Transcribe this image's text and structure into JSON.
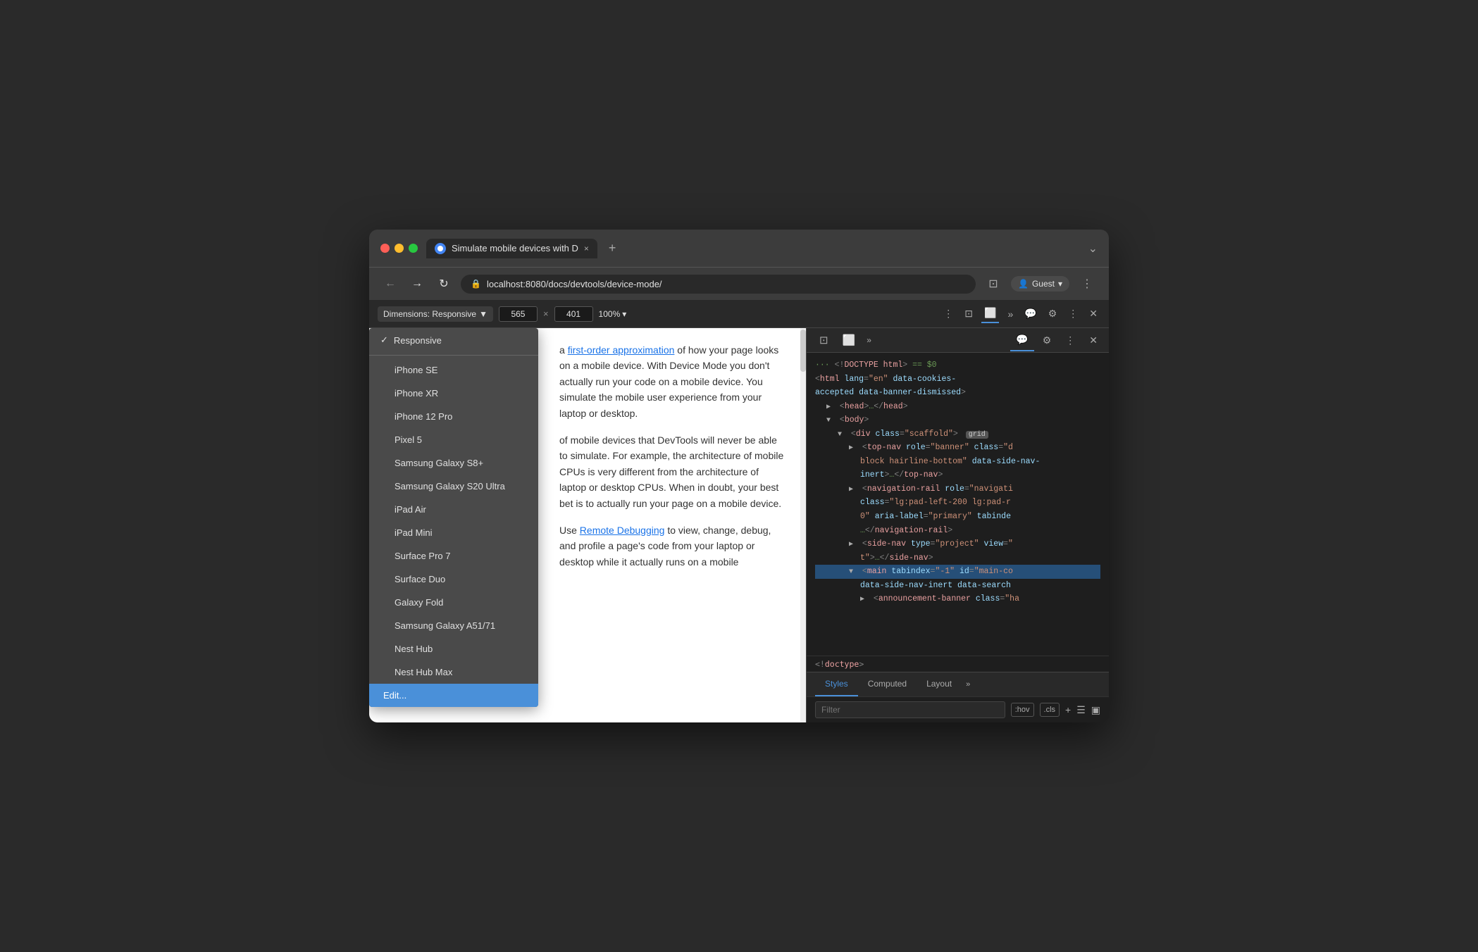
{
  "browser": {
    "tab_title": "Simulate mobile devices with D",
    "tab_close": "×",
    "new_tab": "+",
    "tab_menu": "⌄",
    "address": "localhost:8080/docs/devtools/device-mode/",
    "back_btn": "←",
    "forward_btn": "→",
    "refresh_btn": "↻",
    "profile_icon": "👤",
    "profile_label": "Guest",
    "profile_chevron": "▾",
    "browser_menu": "⋮"
  },
  "devtools_toolbar": {
    "dimensions_label": "Dimensions: Responsive",
    "dimensions_arrow": "▼",
    "width_value": "565",
    "height_value": "401",
    "zoom_label": "100%",
    "zoom_arrow": "▾",
    "more_icon": "⋮"
  },
  "device_dropdown": {
    "items": [
      {
        "id": "responsive",
        "label": "Responsive",
        "checked": true
      },
      {
        "id": "iphone-se",
        "label": "iPhone SE",
        "checked": false
      },
      {
        "id": "iphone-xr",
        "label": "iPhone XR",
        "checked": false
      },
      {
        "id": "iphone-12-pro",
        "label": "iPhone 12 Pro",
        "checked": false
      },
      {
        "id": "pixel-5",
        "label": "Pixel 5",
        "checked": false
      },
      {
        "id": "samsung-s8",
        "label": "Samsung Galaxy S8+",
        "checked": false
      },
      {
        "id": "samsung-s20",
        "label": "Samsung Galaxy S20 Ultra",
        "checked": false
      },
      {
        "id": "ipad-air",
        "label": "iPad Air",
        "checked": false
      },
      {
        "id": "ipad-mini",
        "label": "iPad Mini",
        "checked": false
      },
      {
        "id": "surface-pro",
        "label": "Surface Pro 7",
        "checked": false
      },
      {
        "id": "surface-duo",
        "label": "Surface Duo",
        "checked": false
      },
      {
        "id": "galaxy-fold",
        "label": "Galaxy Fold",
        "checked": false
      },
      {
        "id": "samsung-a51",
        "label": "Samsung Galaxy A51/71",
        "checked": false
      },
      {
        "id": "nest-hub",
        "label": "Nest Hub",
        "checked": false
      },
      {
        "id": "nest-hub-max",
        "label": "Nest Hub Max",
        "checked": false
      },
      {
        "id": "edit",
        "label": "Edit...",
        "checked": false,
        "special": "edit"
      }
    ]
  },
  "page_content": {
    "paragraph1": "a first-order approximation of how your page looks on a mobile device. With Device Mode you don't actually run your code on a mobile device. You simulate the mobile user experience from your laptop or desktop.",
    "link1": "first-order approximation",
    "paragraph2": "of mobile devices that DevTools will never be able to simulate. For example, the architecture of mobile CPUs is very different from the architecture of laptop or desktop CPUs. When in doubt, your best bet is to actually run your page on a mobile device.",
    "paragraph3_start": "Use ",
    "link2": "Remote Debugging",
    "paragraph3_end": " to view, change, debug, and profile a page's code from your laptop or desktop while it actually runs on a mobile"
  },
  "devtools": {
    "tabs": [
      {
        "id": "cursor",
        "icon": "⊡",
        "active": false
      },
      {
        "id": "device",
        "icon": "⬜",
        "active": false
      },
      {
        "id": "more",
        "icon": "»",
        "active": false
      },
      {
        "id": "console",
        "icon": "💬",
        "active": true
      },
      {
        "id": "settings",
        "icon": "⚙",
        "active": false
      },
      {
        "id": "more2",
        "icon": "⋮",
        "active": false
      },
      {
        "id": "close",
        "icon": "×",
        "active": false
      }
    ],
    "dom_tree": [
      {
        "indent": 0,
        "content": "···<!DOCTYPE html> == $0",
        "type": "comment-line"
      },
      {
        "indent": 0,
        "content": "<html",
        "attrs": "lang=\"en\" data-cookies-accepted data-banner-dismissed>",
        "type": "tag-open"
      },
      {
        "indent": 1,
        "content": "<head>…</head>",
        "type": "collapsed",
        "triangle": "▶"
      },
      {
        "indent": 1,
        "content": "<body>",
        "type": "tag-open-only",
        "triangle": "▼"
      },
      {
        "indent": 2,
        "content": "<div class=\"scaffold\">",
        "badge": "grid",
        "type": "tag",
        "triangle": "▼"
      },
      {
        "indent": 3,
        "content": "<top-nav role=\"banner\" class=\"d block hairline-bottom\" data-side-nav-inert>…</top-nav>",
        "type": "collapsed",
        "triangle": "▶"
      },
      {
        "indent": 3,
        "content": "<navigation-rail role=\"navigati class=\"lg:pad-left-200 lg:pad-r 0\" aria-label=\"primary\" tabinde …</navigation-rail>",
        "type": "collapsed",
        "triangle": "▶"
      },
      {
        "indent": 3,
        "content": "<side-nav type=\"project\" view=\"t\">…</side-nav>",
        "type": "collapsed",
        "triangle": "▶"
      },
      {
        "indent": 3,
        "content": "<main tabindex=\"-1\" id=\"main-co data-side-nav-inert data-search",
        "type": "tag-open",
        "triangle": "▼"
      },
      {
        "indent": 4,
        "content": "<announcement-banner class=\"ha",
        "type": "partial"
      }
    ],
    "doctype": "<!doctype>",
    "bottom_tabs": [
      {
        "id": "styles",
        "label": "Styles",
        "active": true
      },
      {
        "id": "computed",
        "label": "Computed",
        "active": false
      },
      {
        "id": "layout",
        "label": "Layout",
        "active": false
      },
      {
        "id": "more",
        "label": "»",
        "active": false
      }
    ],
    "filter_placeholder": "Filter",
    "filter_hov": ":hov",
    "filter_cls": ".cls",
    "filter_add": "+",
    "filter_icon1": "☰",
    "filter_icon2": "▣"
  }
}
